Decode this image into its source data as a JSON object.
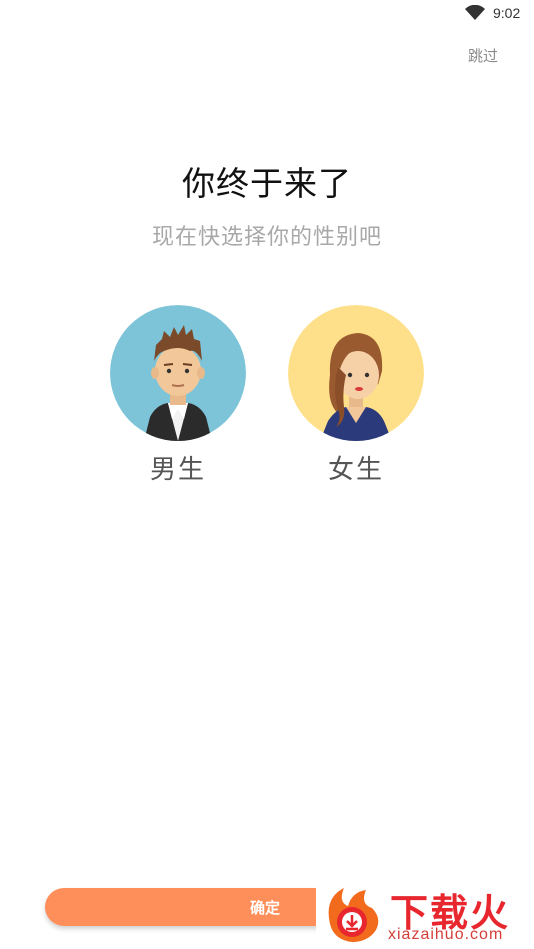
{
  "status_bar": {
    "time": "9:02",
    "wifi_icon": "wifi-icon"
  },
  "header": {
    "skip_label": "跳过"
  },
  "main": {
    "title": "你终于来了",
    "subtitle": "现在快选择你的性别吧",
    "genders": [
      {
        "label": "男生",
        "avatar": "male-avatar",
        "bg_color": "#7ec4d9"
      },
      {
        "label": "女生",
        "avatar": "female-avatar",
        "bg_color": "#ffe08a"
      }
    ]
  },
  "footer": {
    "confirm_label": "确定",
    "accent_color": "#ff8f5a"
  },
  "watermark": {
    "brand": "下载火",
    "url": "xiazaihuo.com"
  }
}
